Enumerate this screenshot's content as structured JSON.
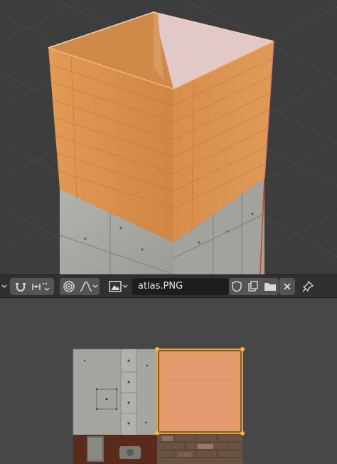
{
  "image_editor": {
    "image_name": "atlas.PNG"
  },
  "icons": [
    "dropdown-chevron-icon",
    "magnet-snap-icon",
    "snap-increment-icon",
    "proportional-edit-icon",
    "falloff-curve-icon",
    "image-browse-icon",
    "fake-user-shield-icon",
    "duplicate-image-icon",
    "open-folder-icon",
    "close-icon",
    "pin-icon"
  ],
  "colors": {
    "viewport_bg": "#3d3d3d",
    "header_bg": "#303030",
    "uv_editor_bg": "#474747",
    "wood": "#d9924c",
    "selection_orange": "#f0a030",
    "concrete": "#a9a9a4"
  }
}
